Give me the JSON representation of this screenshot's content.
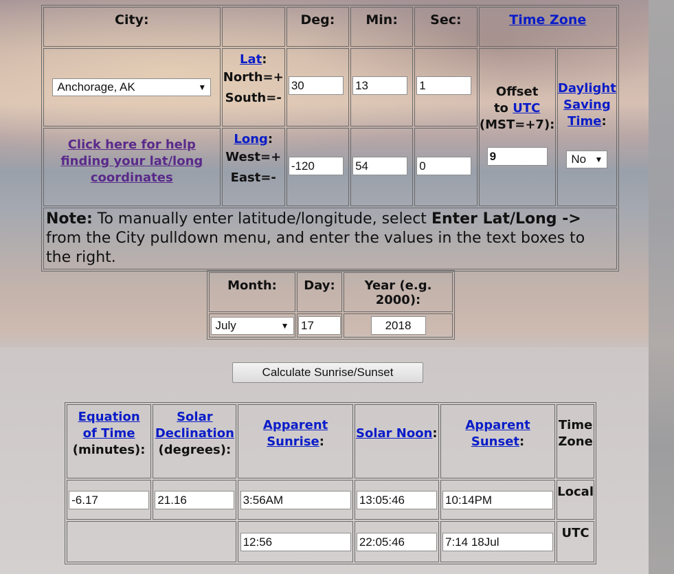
{
  "location": {
    "headers": {
      "city": "City:",
      "deg": "Deg:",
      "min": "Min:",
      "sec": "Sec:",
      "time_zone": "Time Zone"
    },
    "city_select": "Anchorage, AK",
    "lat": {
      "label": "Lat",
      "colon": ":",
      "north": "North=+",
      "south": "South=-",
      "deg": "30",
      "min": "13",
      "sec": "1"
    },
    "long": {
      "label": "Long",
      "colon": ":",
      "west": "West=+",
      "east": "East=-",
      "deg": "-120",
      "min": "54",
      "sec": "0"
    },
    "help_link": "Click here for help finding your lat/long coordinates",
    "offset": {
      "line1": "Offset",
      "to": "to ",
      "utc": "UTC",
      "line3": "(MST=+7):",
      "value": "9"
    },
    "dst": {
      "daylight": "Daylight",
      "saving": "Saving",
      "time": "Time",
      "colon": ":",
      "value": "No"
    },
    "note": {
      "bold": "Note:",
      "text1": " To manually enter latitude/longitude, select ",
      "bold2": "Enter Lat/Long ->",
      "text2": " from the City pulldown menu, and enter the values in the text boxes to the right."
    }
  },
  "date": {
    "month_label": "Month:",
    "day_label": "Day:",
    "year_label": "Year (e.g. 2000):",
    "month": "July",
    "day": "17",
    "year": "2018"
  },
  "calculate_button": "Calculate Sunrise/Sunset",
  "results": {
    "headers": {
      "eot1": "Equation ",
      "eot2": "of Time",
      "eot3": "(minutes):",
      "decl1": "Solar",
      "decl2": "Declination",
      "decl3": "(degrees):",
      "sunrise1": "Apparent",
      "sunrise2": "Sunrise",
      "sunrise_colon": ":",
      "noon": "Solar Noon",
      "noon_colon": ":",
      "sunset1": "Apparent",
      "sunset2": "Sunset",
      "sunset_colon": ":",
      "tz1": "Time",
      "tz2": "Zone"
    },
    "local": {
      "eot": "-6.17",
      "decl": "21.16",
      "sunrise": "3:56AM",
      "noon": "13:05:46",
      "sunset": "10:14PM",
      "label": "Local"
    },
    "utc": {
      "sunrise": "12:56",
      "noon": "22:05:46",
      "sunset": "7:14 18Jul",
      "label": "UTC"
    }
  }
}
